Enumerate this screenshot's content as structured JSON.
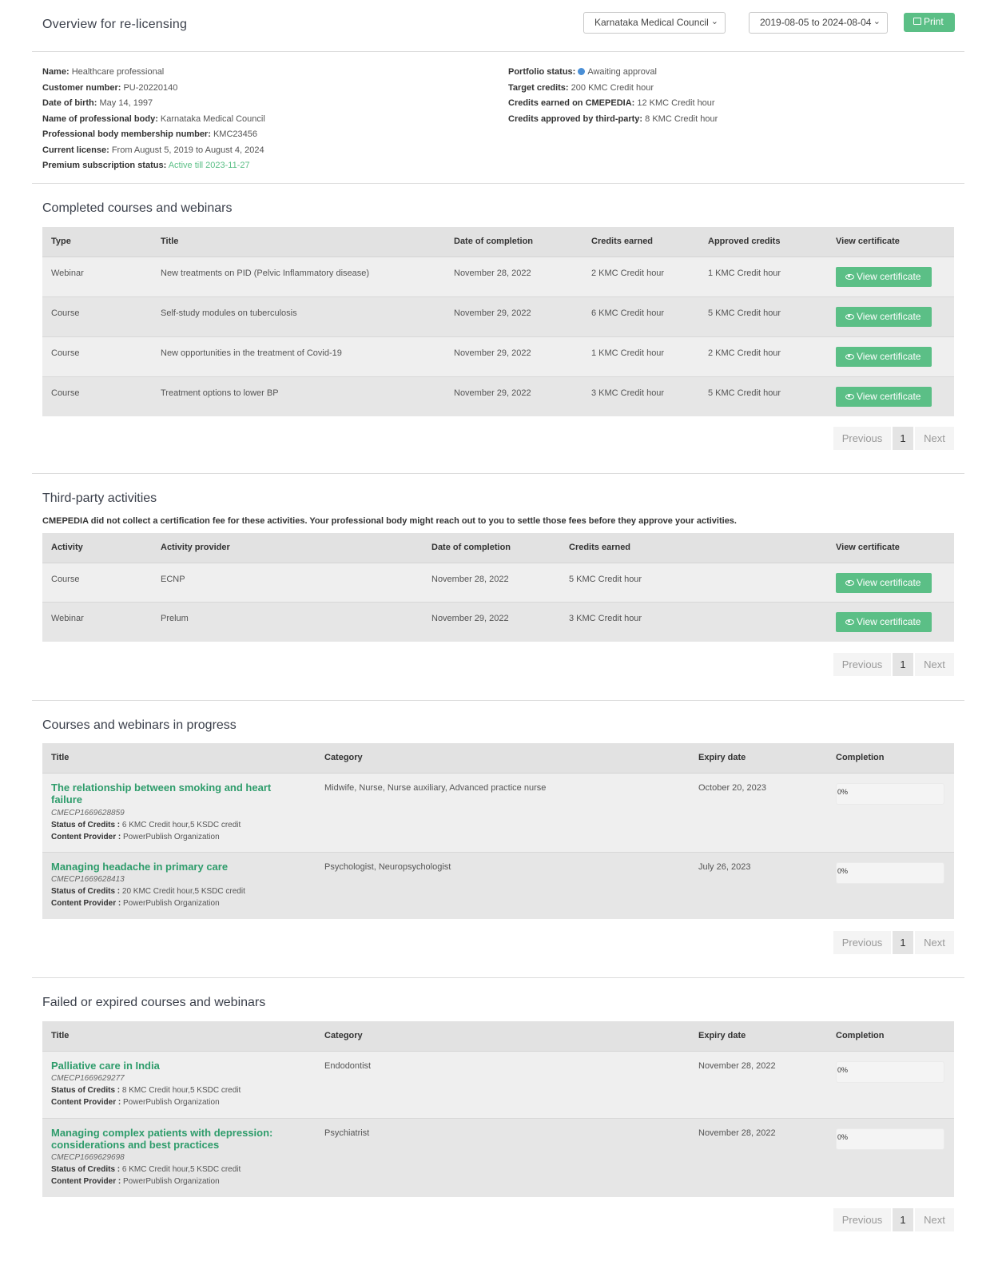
{
  "header": {
    "title": "Overview for re-licensing",
    "council_select": "Karnataka Medical Council",
    "date_select": "2019-08-05 to 2024-08-04",
    "print_label": "Print"
  },
  "profile_left": [
    {
      "label": "Name:",
      "value": "Healthcare professional"
    },
    {
      "label": "Customer number:",
      "value": "PU-20220140"
    },
    {
      "label": "Date of birth:",
      "value": "May 14, 1997"
    },
    {
      "label": "Name of professional body:",
      "value": "Karnataka Medical Council"
    },
    {
      "label": "Professional body membership number:",
      "value": "KMC23456"
    },
    {
      "label": "Current license:",
      "value": "From August 5, 2019 to August 4, 2024"
    },
    {
      "label": "Premium subscription status:",
      "value": "Active till 2023-11-27"
    }
  ],
  "profile_right": [
    {
      "label": "Portfolio status:",
      "value": "Awaiting approval"
    },
    {
      "label": "Target credits:",
      "value": "200 KMC Credit hour"
    },
    {
      "label": "Credits earned on CMEPEDIA:",
      "value": "12 KMC Credit hour"
    },
    {
      "label": "Credits approved by third-party:",
      "value": "8 KMC Credit hour"
    }
  ],
  "status_dot_color": "#4a8fd6",
  "accent_color": "#5bbf86",
  "completed": {
    "title": "Completed courses and webinars",
    "headers": [
      "Type",
      "Title",
      "Date of completion",
      "Credits earned",
      "Approved credits",
      "View certificate"
    ],
    "rows": [
      [
        "Webinar",
        "New treatments on PID (Pelvic Inflammatory disease)",
        "November 28, 2022",
        "2 KMC Credit hour",
        "1 KMC Credit hour"
      ],
      [
        "Course",
        "Self-study modules on tuberculosis",
        "November 29, 2022",
        "6 KMC Credit hour",
        "5 KMC Credit hour"
      ],
      [
        "Course",
        "New opportunities in the treatment of Covid-19",
        "November 29, 2022",
        "1 KMC Credit hour",
        "2 KMC Credit hour"
      ],
      [
        "Course",
        "Treatment options to lower BP",
        "November 29, 2022",
        "3 KMC Credit hour",
        "5 KMC Credit hour"
      ]
    ],
    "button_label": "View certificate"
  },
  "third_party": {
    "title": "Third-party activities",
    "note": "CMEPEDIA did not collect a certification fee for these activities. Your professional body might reach out to you to settle those fees before they approve your activities.",
    "headers": [
      "Activity",
      "Activity provider",
      "Date of completion",
      "Credits earned",
      "View certificate"
    ],
    "rows": [
      [
        "Course",
        "ECNP",
        "November 28, 2022",
        "5 KMC Credit hour"
      ],
      [
        "Webinar",
        "Prelum",
        "November 29, 2022",
        "3 KMC Credit hour"
      ]
    ],
    "button_label": "View certificate"
  },
  "in_progress": {
    "title": "Courses and webinars in progress",
    "headers": [
      "Title",
      "Category",
      "Expiry date",
      "Completion"
    ],
    "rows": [
      {
        "title": "The relationship between smoking and heart failure",
        "code": "CMECP1669628859",
        "credits_label": "Status of Credits :",
        "credits": "6 KMC Credit hour,5 KSDC credit",
        "provider_label": "Content Provider :",
        "provider": "PowerPublish Organization",
        "category": "Midwife, Nurse, Nurse auxiliary, Advanced practice nurse",
        "expiry": "October 20, 2023",
        "completion": "0%",
        "completion_value": 0
      },
      {
        "title": "Managing headache in primary care",
        "code": "CMECP1669628413",
        "credits_label": "Status of Credits :",
        "credits": "20 KMC Credit hour,5 KSDC credit",
        "provider_label": "Content Provider :",
        "provider": "PowerPublish Organization",
        "category": "Psychologist, Neuropsychologist",
        "expiry": "July 26, 2023",
        "completion": "0%",
        "completion_value": 0
      }
    ]
  },
  "failed": {
    "title": "Failed or expired courses and webinars",
    "headers": [
      "Title",
      "Category",
      "Expiry date",
      "Completion"
    ],
    "rows": [
      {
        "title": "Palliative care in India",
        "code": "CMECP1669629277",
        "credits_label": "Status of Credits :",
        "credits": "8 KMC Credit hour,5 KSDC credit",
        "provider_label": "Content Provider :",
        "provider": "PowerPublish Organization",
        "category": "Endodontist",
        "expiry": "November 28, 2022",
        "completion": "0%",
        "completion_value": 0
      },
      {
        "title": "Managing complex patients with depression: considerations and best practices",
        "code": "CMECP1669629698",
        "credits_label": "Status of Credits :",
        "credits": "6 KMC Credit hour,5 KSDC credit",
        "provider_label": "Content Provider :",
        "provider": "PowerPublish Organization",
        "category": "Psychiatrist",
        "expiry": "November 28, 2022",
        "completion": "0%",
        "completion_value": 0
      }
    ]
  },
  "pagination": {
    "previous": "Previous",
    "page": "1",
    "next": "Next"
  }
}
